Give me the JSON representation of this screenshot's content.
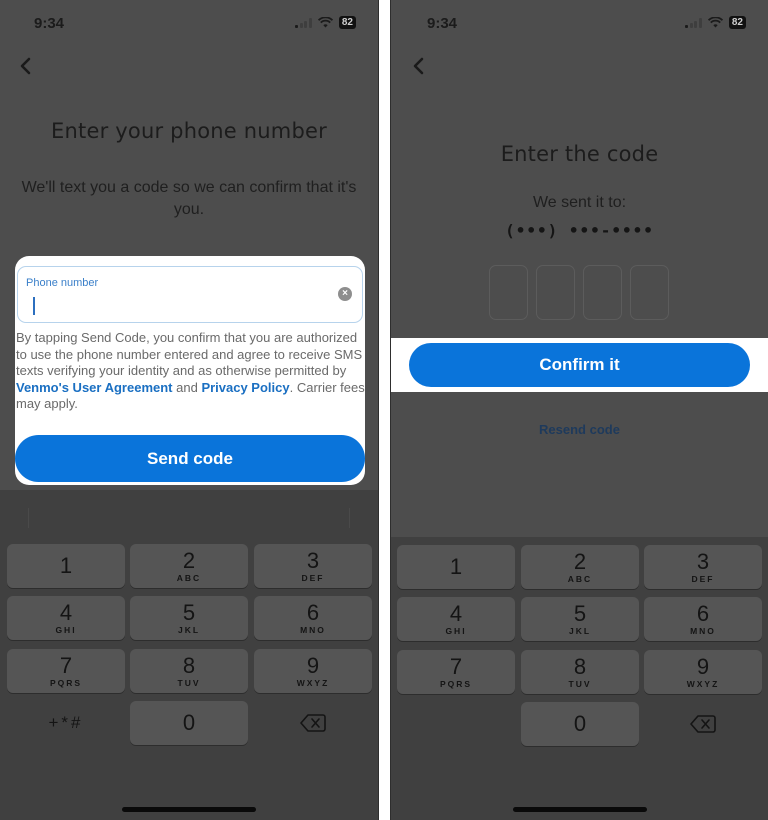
{
  "status_bar": {
    "time": "9:34",
    "battery": "82"
  },
  "colors": {
    "accent": "#0a74da",
    "link": "#1a6fc2",
    "overlay": "#4d4d4d",
    "keyboard": "#404040"
  },
  "left_screen": {
    "back_icon": "chevron-left",
    "title": "Enter your phone number",
    "subtitle": "We'll text you a code so we can confirm that it's you.",
    "phone_field": {
      "label": "Phone number",
      "value": "",
      "clear_icon": "x-circle"
    },
    "legal": {
      "part1": "By tapping Send Code, you confirm that you are authorized to use the phone number entered and agree to receive SMS texts verifying your identity and as otherwise permitted by ",
      "link1": "Venmo's User Agreement",
      "part2": " and ",
      "link2": "Privacy Policy",
      "part3": ". Carrier fees may apply."
    },
    "send_button": "Send code",
    "special_key": "+*#"
  },
  "right_screen": {
    "back_icon": "chevron-left",
    "title": "Enter the code",
    "sent_to_label": "We sent it to:",
    "phone_masked": "(•••) •••-••••",
    "code_digits": [
      "",
      "",
      "",
      ""
    ],
    "confirm_button": "Confirm it",
    "resend_link": "Resend code"
  },
  "keypad": [
    {
      "num": "1",
      "letters": ""
    },
    {
      "num": "2",
      "letters": "ABC"
    },
    {
      "num": "3",
      "letters": "DEF"
    },
    {
      "num": "4",
      "letters": "GHI"
    },
    {
      "num": "5",
      "letters": "JKL"
    },
    {
      "num": "6",
      "letters": "MNO"
    },
    {
      "num": "7",
      "letters": "PQRS"
    },
    {
      "num": "8",
      "letters": "TUV"
    },
    {
      "num": "9",
      "letters": "WXYZ"
    },
    {
      "num": "0",
      "letters": ""
    }
  ]
}
